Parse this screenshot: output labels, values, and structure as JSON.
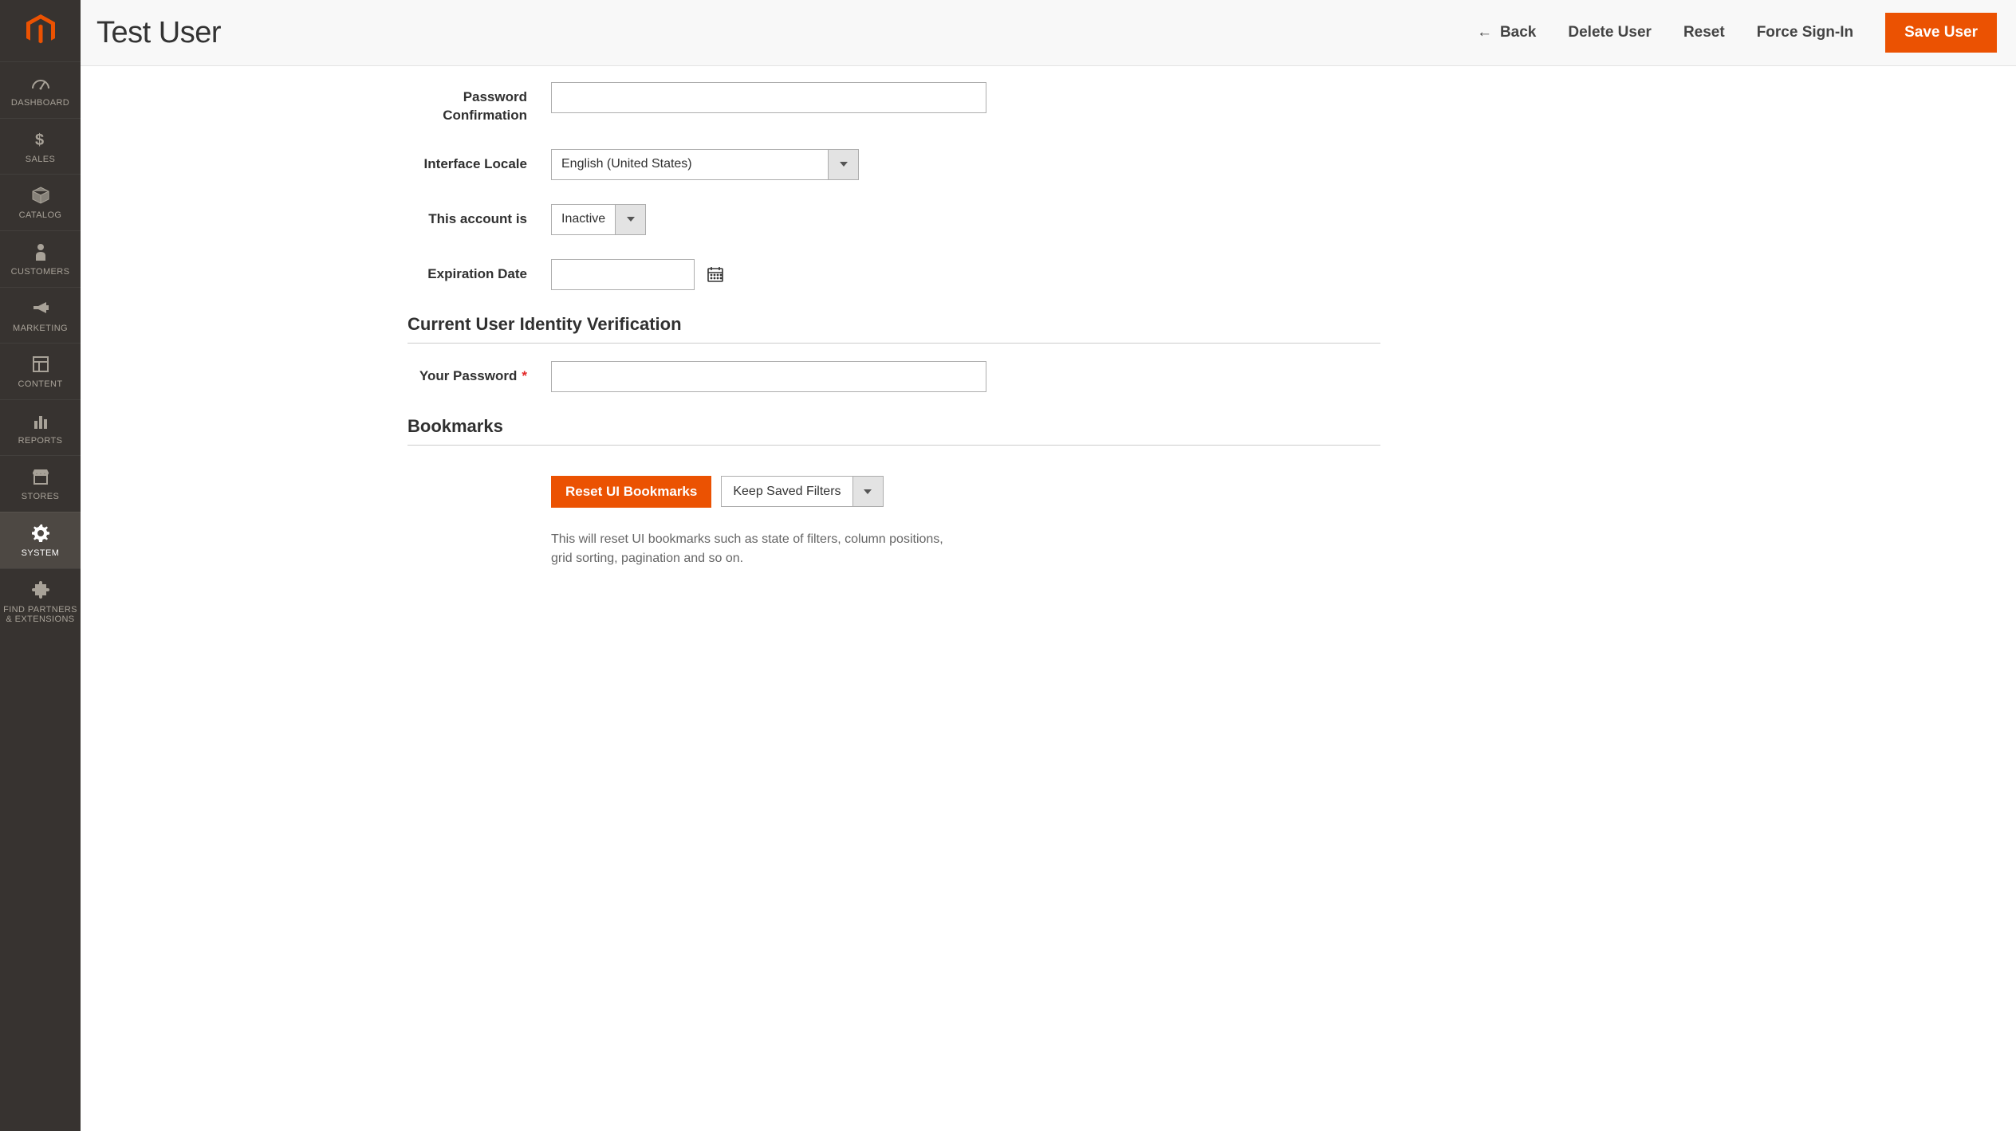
{
  "header": {
    "title": "Test User",
    "back": "Back",
    "delete_user": "Delete User",
    "reset": "Reset",
    "force_signin": "Force Sign-In",
    "save_user": "Save User"
  },
  "sidebar": {
    "items": [
      {
        "label": "DASHBOARD"
      },
      {
        "label": "SALES"
      },
      {
        "label": "CATALOG"
      },
      {
        "label": "CUSTOMERS"
      },
      {
        "label": "MARKETING"
      },
      {
        "label": "CONTENT"
      },
      {
        "label": "REPORTS"
      },
      {
        "label": "STORES"
      },
      {
        "label": "SYSTEM"
      },
      {
        "label": "FIND PARTNERS & EXTENSIONS"
      }
    ]
  },
  "form": {
    "password_confirmation_label": "Password Confirmation",
    "password_confirmation_value": "",
    "interface_locale_label": "Interface Locale",
    "interface_locale_value": "English (United States)",
    "account_is_label": "This account is",
    "account_is_value": "Inactive",
    "expiration_date_label": "Expiration Date",
    "expiration_date_value": ""
  },
  "identity": {
    "section_title": "Current User Identity Verification",
    "your_password_label": "Your Password",
    "your_password_value": ""
  },
  "bookmarks": {
    "section_title": "Bookmarks",
    "reset_button": "Reset UI Bookmarks",
    "filter_option": "Keep Saved Filters",
    "hint": "This will reset UI bookmarks such as state of filters, column positions, grid sorting, pagination and so on."
  }
}
